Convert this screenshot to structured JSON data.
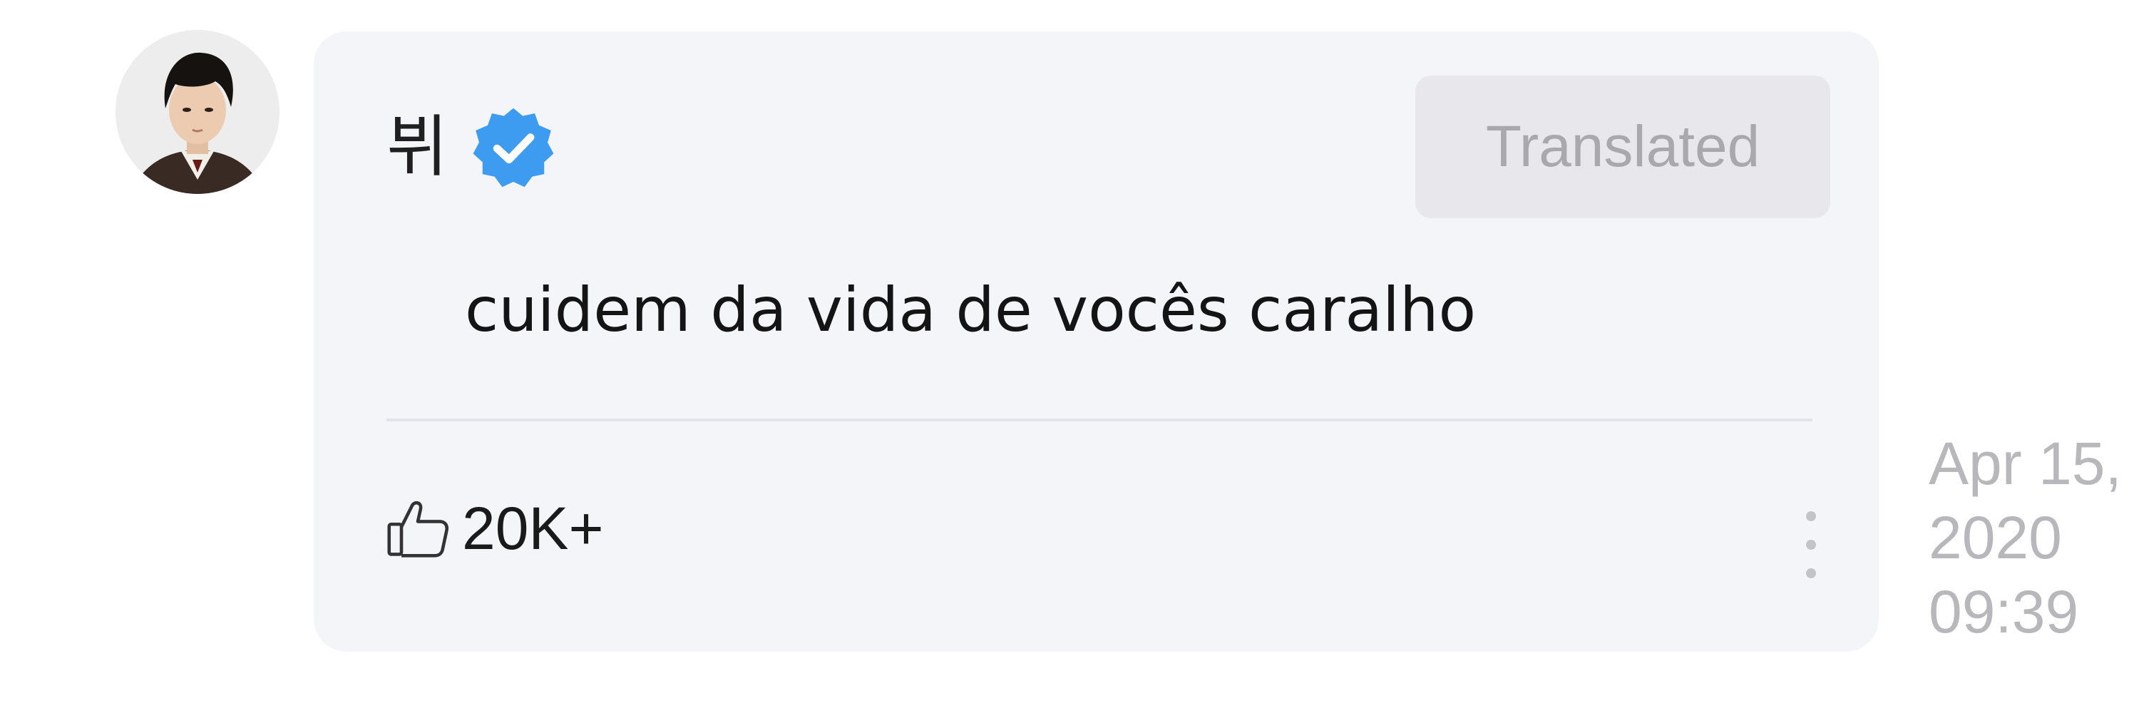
{
  "post": {
    "username": "뷔",
    "verified": true,
    "translated_label": "Translated",
    "message": "cuidem da vida de vocês caralho",
    "likes": "20K+",
    "timestamp": {
      "line1": "Apr 15,",
      "line2": "2020",
      "line3": "09:39"
    }
  },
  "icons": {
    "avatar": "profile-photo",
    "verified": "verified-badge-icon",
    "like": "thumbs-up-icon",
    "more": "more-vertical-icon"
  },
  "colors": {
    "card_background": "#f4f5f9",
    "verified_blue": "#3d9bf0",
    "translated_bg": "#e8e8ec",
    "translated_text": "#a9a9ad",
    "timestamp_text": "#b8b8bc"
  }
}
